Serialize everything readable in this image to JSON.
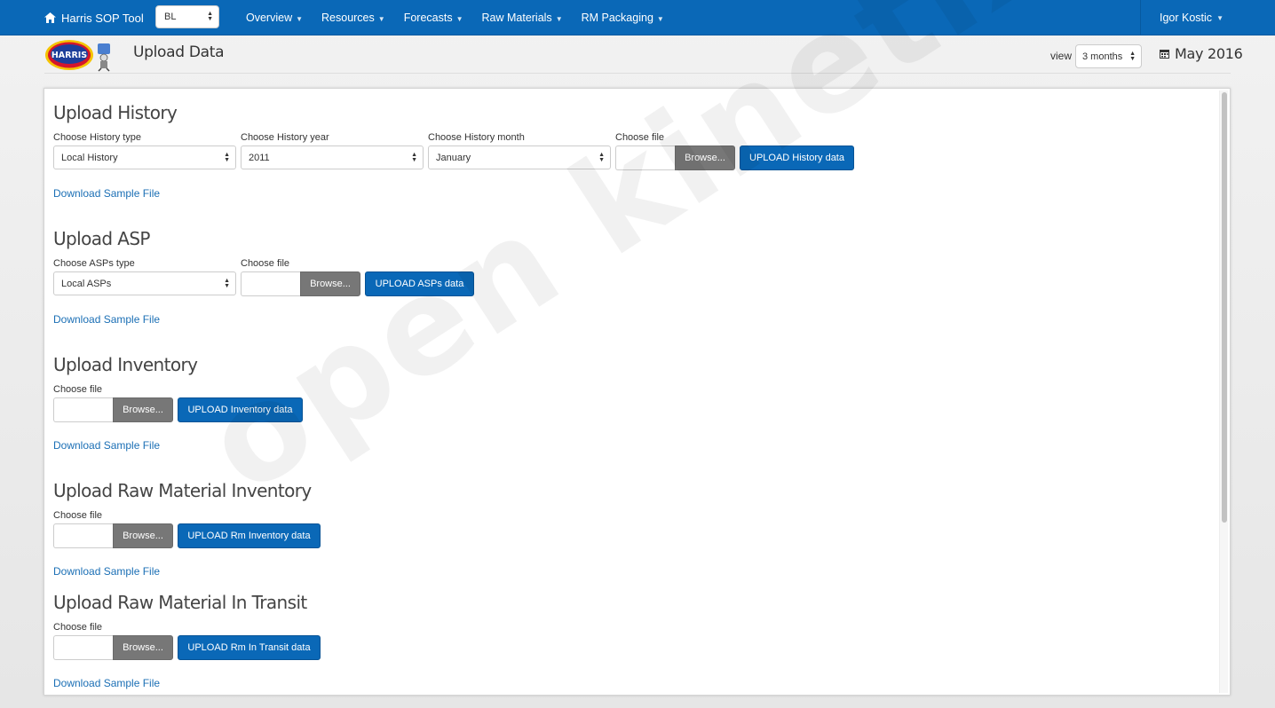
{
  "navbar": {
    "brand": "Harris SOP Tool",
    "unit_select": "BL",
    "menu": [
      {
        "label": "Overview"
      },
      {
        "label": "Resources"
      },
      {
        "label": "Forecasts"
      },
      {
        "label": "Raw Materials"
      },
      {
        "label": "RM Packaging"
      }
    ],
    "user": "Igor Kostic"
  },
  "header": {
    "logo_text": "HARRIS",
    "title": "Upload Data",
    "view_label": "view",
    "view_select": "3 months",
    "date": "May 2016"
  },
  "sections": {
    "history": {
      "title": "Upload History",
      "type_label": "Choose History type",
      "type_value": "Local History",
      "year_label": "Choose History year",
      "year_value": "2011",
      "month_label": "Choose History month",
      "month_value": "January",
      "file_label": "Choose file",
      "browse": "Browse...",
      "upload": "UPLOAD History data",
      "sample": "Download Sample File"
    },
    "asp": {
      "title": "Upload ASP",
      "type_label": "Choose ASPs type",
      "type_value": "Local ASPs",
      "file_label": "Choose file",
      "browse": "Browse...",
      "upload": "UPLOAD ASPs data",
      "sample": "Download Sample File"
    },
    "inventory": {
      "title": "Upload Inventory",
      "file_label": "Choose file",
      "browse": "Browse...",
      "upload": "UPLOAD Inventory data",
      "sample": "Download Sample File"
    },
    "rm_inventory": {
      "title": "Upload Raw Material Inventory",
      "file_label": "Choose file",
      "browse": "Browse...",
      "upload": "UPLOAD Rm Inventory data",
      "sample": "Download Sample File"
    },
    "rm_transit": {
      "title": "Upload Raw Material In Transit",
      "file_label": "Choose file",
      "browse": "Browse...",
      "upload": "UPLOAD Rm In Transit data",
      "sample": "Download Sample File"
    }
  },
  "watermark": "open kinetix",
  "colors": {
    "navbar": "#0a68b7",
    "primary_button": "#0a68b7",
    "browse_button": "#777777",
    "link": "#1b6fb5"
  }
}
